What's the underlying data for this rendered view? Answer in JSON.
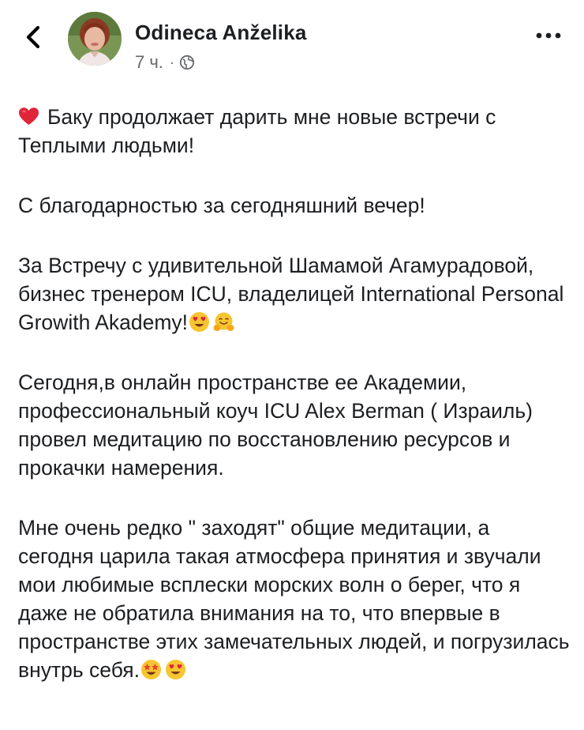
{
  "header": {
    "author_name": "Odineca Anželika",
    "time": "7 ч.",
    "separator": "·",
    "visibility_icon": "globe-icon",
    "back_icon": "chevron-left-icon",
    "more_icon": "more-dots-icon"
  },
  "post": {
    "paragraphs": [
      "Баку продолжает дарить мне новые встречи с Теплыми людьми!",
      "С благодарностью за сегодняшний вечер!",
      "За Встречу с удивительной Шамамой Агамурадовой, бизнес тренером ICU, владелицей International Personal Growith Akademy!",
      "Сегодня,в онлайн пространстве ее Академии, профессиональный коуч ICU Alex Berman ( Израиль) провел медитацию по восстановлению ресурсов и прокачки намерения.",
      "Мне очень редко \" заходят\" общие медитации, а сегодня царила такая атмосфера принятия и звучали мои любимые всплески морских волн о берег, что я даже не обратила внимания на то, что впервые в пространстве этих замечательных людей, и погрузилась внутрь себя."
    ],
    "emojis": {
      "p1_start": "red-heart-emoji",
      "p3_end": [
        "heart-eyes-emoji",
        "hugging-face-emoji"
      ],
      "p5_end": [
        "star-struck-emoji",
        "heart-eyes-emoji"
      ]
    }
  },
  "colors": {
    "text": "#1c1e21",
    "secondary": "#65676b",
    "heart": "#e0243a",
    "emoji_yellow": "#f7c531"
  }
}
